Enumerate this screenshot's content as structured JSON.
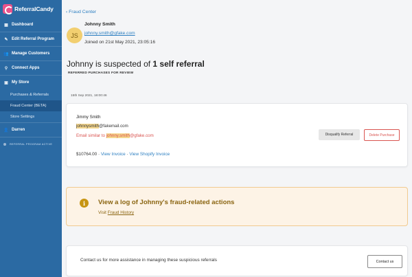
{
  "brand": {
    "name": "ReferralCandy"
  },
  "sidebar": {
    "items": [
      {
        "label": "Dashboard",
        "icon": "dashboard-icon",
        "glyph": "▦"
      },
      {
        "label": "Edit Referral Program",
        "icon": "edit-icon",
        "glyph": "✎"
      },
      {
        "label": "Manage Customers",
        "icon": "users-icon",
        "glyph": "👥"
      },
      {
        "label": "Connect Apps",
        "icon": "plug-icon",
        "glyph": "⚲"
      },
      {
        "label": "My Store",
        "icon": "store-icon",
        "glyph": "▣"
      }
    ],
    "store_sub": [
      "Purchases & Referrals",
      "Fraud Center (BETA)",
      "Store Settings"
    ],
    "account": {
      "label": "Darren",
      "glyph": "👤"
    },
    "status": "REFERRAL PROGRAM ACTIVE"
  },
  "main": {
    "back_link": "Fraud Center",
    "user": {
      "initials": "JS",
      "name": "Johnny Smith",
      "email": "johnny.smith@gfake.com",
      "joined": "Joined on 21st May 2021, 23:05:16"
    },
    "headline_prefix": "Johnny is suspected of ",
    "headline_bold": "1 self referral",
    "sub_heading": "REFERRED PURCHASES FOR REVIEW",
    "timestamp": "15th Sep 2021, 18:00:46"
  },
  "referral": {
    "name": "Jimmy Smith",
    "email_highlight": "johnnysmith",
    "email_rest": "@fakemail.com",
    "warn_prefix": "Email similar to ",
    "warn_highlight": "johnny.smith",
    "warn_rest": "@gfake.com",
    "amount": "$10764.00",
    "sep": " · ",
    "view_invoice": "View Invoice",
    "view_shopify": "View Shopify Invoice",
    "disqualify": "Disqualify Referral",
    "delete": "Delete Purchase"
  },
  "fraud_log": {
    "title": "View a log of Johnny's fraud-related actions",
    "visit": "Visit ",
    "link": "Fraud History"
  },
  "contact": {
    "text": "Contact us for more assistance in managing these suspicious referrals",
    "button": "Contact us"
  },
  "colors": {
    "sidebar": "#2b6aa3",
    "accent": "#2d7fc1",
    "danger": "#d9534f",
    "warning_bg": "#fdf3e6",
    "warning_text": "#8a6410"
  }
}
